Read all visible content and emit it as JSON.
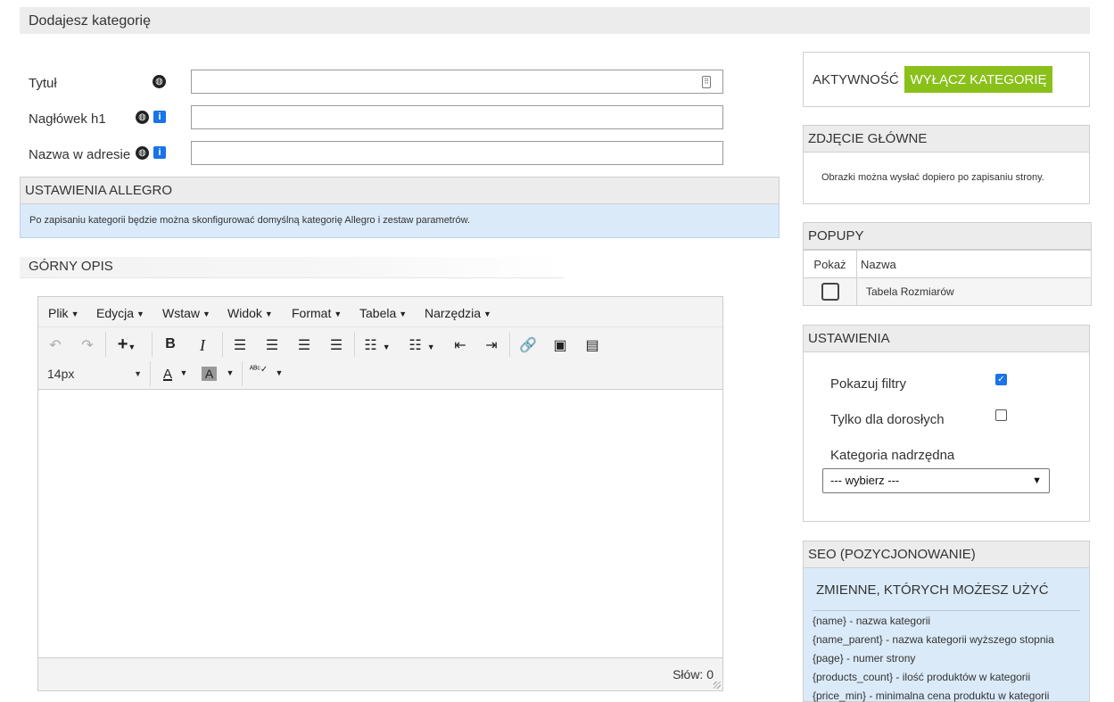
{
  "page": {
    "title": "Dodajesz kategorię"
  },
  "form": {
    "title_label": "Tytuł",
    "h1_label": "Nagłówek h1",
    "url_label": "Nazwa w adresie",
    "title_value": "",
    "h1_value": "",
    "url_value": ""
  },
  "allegro": {
    "header": "USTAWIENIA ALLEGRO",
    "note": "Po zapisaniu kategorii będzie można skonfigurować domyślną kategorię Allegro i zestaw parametrów."
  },
  "top_description": {
    "title": "GÓRNY OPIS"
  },
  "editor": {
    "menu": [
      "Plik",
      "Edycja",
      "Wstaw",
      "Widok",
      "Format",
      "Tabela",
      "Narzędzia"
    ],
    "font_size": "14px",
    "word_count": "Słów: 0"
  },
  "activity": {
    "label": "AKTYWNOŚĆ",
    "button": "WYŁĄCZ KATEGORIĘ",
    "button_color": "#8ac01a"
  },
  "main_photo": {
    "header": "ZDJĘCIE GŁÓWNE",
    "note": "Obrazki można wysłać dopiero po zapisaniu strony."
  },
  "popups": {
    "header": "POPUPY",
    "col_show": "Pokaż",
    "col_name": "Nazwa",
    "rows": [
      {
        "name": "Tabela Rozmiarów",
        "checked": false
      }
    ]
  },
  "settings": {
    "header": "USTAWIENIA",
    "show_filters_label": "Pokazuj filtry",
    "show_filters_checked": true,
    "adults_only_label": "Tylko dla dorosłych",
    "adults_only_checked": false,
    "parent_label": "Kategoria nadrzędna",
    "parent_selected": "--- wybierz ---"
  },
  "seo": {
    "header": "SEO (POZYCJONOWANIE)",
    "variables_title": "ZMIENNE, KTÓRYCH MOŻESZ UŻYĆ",
    "variables": [
      "{name} - nazwa kategorii",
      "{name_parent} - nazwa kategorii wyższego stopnia",
      "{page} - numer strony",
      "{products_count} - ilość produktów w kategorii",
      "{price_min} - minimalna cena produktu w kategorii"
    ]
  }
}
